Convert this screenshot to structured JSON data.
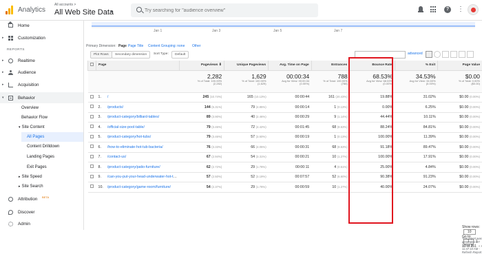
{
  "app": {
    "title": "Analytics",
    "account_small": "All accounts >",
    "account_big": "All Web Site Data"
  },
  "search": {
    "placeholder": "Try searching for \"audience overview\""
  },
  "sidebar": {
    "top_items": [
      {
        "label": "Home",
        "icon": "home-icon"
      },
      {
        "label": "Customization",
        "icon": "customization-icon"
      }
    ],
    "reports_header": "REPORTS",
    "report_items": [
      {
        "label": "Realtime"
      },
      {
        "label": "Audience"
      },
      {
        "label": "Acquisition"
      },
      {
        "label": "Behavior"
      }
    ],
    "behavior_sub": [
      "Overview",
      "Behavior Flow"
    ],
    "site_content": "Site Content",
    "site_content_sub": [
      "All Pages",
      "Content Drilldown",
      "Landing Pages",
      "Exit Pages"
    ],
    "other_sub": [
      "Site Speed",
      "Site Search"
    ],
    "bottom_items": [
      {
        "label": "Attribution",
        "badge": "BETA"
      },
      {
        "label": "Discover"
      },
      {
        "label": "Admin"
      }
    ]
  },
  "chart": {
    "labels": [
      "Jan 1",
      "Jan 3",
      "Jan 5",
      "Jan 7"
    ]
  },
  "dimensions": {
    "label": "Primary Dimension:",
    "active": "Page",
    "options": [
      "Page Title",
      "Content Grouping: none",
      "Other"
    ]
  },
  "controls": {
    "plot_rows": "Plot Rows",
    "secondary": "Secondary dimension",
    "sort_label": "Sort Type:",
    "sort_value": "Default",
    "advanced": "advanced"
  },
  "table": {
    "headers": [
      "Page",
      "Pageviews",
      "Unique Pageviews",
      "Avg. Time on Page",
      "Entrances",
      "Bounce Rate",
      "% Exit",
      "Page Value"
    ],
    "totals": [
      {
        "big": "2,282",
        "sm1": "% of Total: 100.00%",
        "sm2": "(2,282)"
      },
      {
        "big": "1,629",
        "sm1": "% of Total: 100.00%",
        "sm2": "(1,629)"
      },
      {
        "big": "00:00:34",
        "sm1": "Avg for View: 00:00:34",
        "sm2": "(0.00%)"
      },
      {
        "big": "788",
        "sm1": "% of Total: 100.00%",
        "sm2": "(788)"
      },
      {
        "big": "68.53%",
        "sm1": "Avg for View: 68.53%",
        "sm2": "(0.00%)"
      },
      {
        "big": "34.53%",
        "sm1": "Avg for View: 34.53%",
        "sm2": "(0.00%)"
      },
      {
        "big": "$0.00",
        "sm1": "% of Total: 0.00%",
        "sm2": "($0.00)"
      }
    ],
    "rows": [
      {
        "idx": "1.",
        "page": "/",
        "pv": "245",
        "pvp": "(10.74%)",
        "upv": "165",
        "upvp": "(10.13%)",
        "atp": "00:00:44",
        "ent": "161",
        "entp": "(20.43%)",
        "br": "19.88%",
        "ex": "31.02%",
        "val": "$0.00",
        "valp": "(0.00%)"
      },
      {
        "idx": "2.",
        "page": "/products/",
        "pv": "144",
        "pvp": "(6.31%)",
        "upv": "79",
        "upvp": "(4.85%)",
        "atp": "00:00:14",
        "ent": "1",
        "entp": "(0.13%)",
        "br": "0.00%",
        "ex": "6.25%",
        "val": "$0.00",
        "valp": "(0.00%)"
      },
      {
        "idx": "3.",
        "page": "/product-category/billiard-tables/",
        "pv": "89",
        "pvp": "(3.90%)",
        "upv": "40",
        "upvp": "(2.46%)",
        "atp": "00:00:29",
        "ent": "9",
        "entp": "(1.14%)",
        "br": "44.44%",
        "ex": "10.11%",
        "val": "$0.00",
        "valp": "(0.00%)"
      },
      {
        "idx": "4.",
        "page": "/official-size-pool-table/",
        "pv": "79",
        "pvp": "(3.46%)",
        "upv": "72",
        "upvp": "(4.42%)",
        "atp": "00:01:45",
        "ent": "68",
        "entp": "(8.63%)",
        "br": "88.24%",
        "ex": "84.81%",
        "val": "$0.00",
        "valp": "(0.00%)"
      },
      {
        "idx": "5.",
        "page": "/product-category/hot-tubs/",
        "pv": "79",
        "pvp": "(3.46%)",
        "upv": "57",
        "upvp": "(3.50%)",
        "atp": "00:00:19",
        "ent": "1",
        "entp": "(0.13%)",
        "br": "100.00%",
        "ex": "11.39%",
        "val": "$0.00",
        "valp": "(0.00%)"
      },
      {
        "idx": "6.",
        "page": "/how-to-eliminate-hot-tub-bacteria/",
        "pv": "76",
        "pvp": "(3.33%)",
        "upv": "66",
        "upvp": "(4.05%)",
        "atp": "00:00:31",
        "ent": "68",
        "entp": "(8.63%)",
        "br": "91.18%",
        "ex": "89.47%",
        "val": "$0.00",
        "valp": "(0.00%)"
      },
      {
        "idx": "7.",
        "page": "/contact-us/",
        "pv": "67",
        "pvp": "(2.94%)",
        "upv": "54",
        "upvp": "(3.31%)",
        "atp": "00:00:21",
        "ent": "10",
        "entp": "(1.27%)",
        "br": "100.00%",
        "ex": "17.91%",
        "val": "$0.00",
        "valp": "(0.00%)"
      },
      {
        "idx": "8.",
        "page": "/product-category/patio-furniture/",
        "pv": "62",
        "pvp": "(2.72%)",
        "upv": "29",
        "upvp": "(1.78%)",
        "atp": "00:00:11",
        "ent": "4",
        "entp": "(0.51%)",
        "br": "25.00%",
        "ex": "4.84%",
        "val": "$0.00",
        "valp": "(0.00%)"
      },
      {
        "idx": "9.",
        "page": "/can-you-put-your-head-underwater-hot-tub/",
        "pv": "57",
        "pvp": "(2.50%)",
        "upv": "52",
        "upvp": "(3.19%)",
        "atp": "00:07:57",
        "ent": "52",
        "entp": "(6.60%)",
        "br": "90.38%",
        "ex": "91.23%",
        "val": "$0.00",
        "valp": "(0.00%)"
      },
      {
        "idx": "10.",
        "page": "/product-category/game-room/furniture/",
        "pv": "54",
        "pvp": "(2.37%)",
        "upv": "29",
        "upvp": "(1.78%)",
        "atp": "00:00:59",
        "ent": "10",
        "entp": "(1.27%)",
        "br": "40.00%",
        "ex": "24.07%",
        "val": "$0.00",
        "valp": "(0.00%)"
      }
    ]
  },
  "pager": {
    "show_rows": "Show rows:",
    "rows": "10",
    "goto": "Go to:",
    "page": "1",
    "range": "1 - 10 of 251"
  },
  "footnote": "This report was generated on 1/7/21 at 11:47:10 AM - Refresh Report",
  "colors": {
    "highlight": "#e0141e",
    "link": "#1a73e8"
  }
}
